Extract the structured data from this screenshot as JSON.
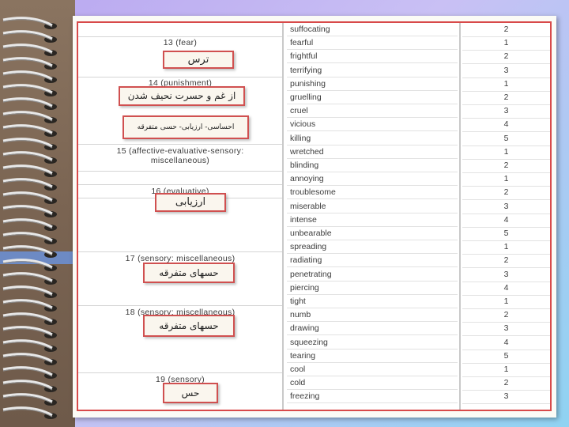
{
  "rows": [
    {
      "word": "suffocating",
      "value": "2"
    },
    {
      "word": "fearful",
      "value": "1"
    },
    {
      "word": "frightful",
      "value": "2"
    },
    {
      "word": "terrifying",
      "value": "3"
    },
    {
      "word": "punishing",
      "value": "1"
    },
    {
      "word": "gruelling",
      "value": "2"
    },
    {
      "word": "cruel",
      "value": "3"
    },
    {
      "word": "vicious",
      "value": "4"
    },
    {
      "word": "killing",
      "value": "5"
    },
    {
      "word": "wretched",
      "value": "1"
    },
    {
      "word": "blinding",
      "value": "2"
    },
    {
      "word": "annoying",
      "value": "1"
    },
    {
      "word": "troublesome",
      "value": "2"
    },
    {
      "word": "miserable",
      "value": "3"
    },
    {
      "word": "intense",
      "value": "4"
    },
    {
      "word": "unbearable",
      "value": "5"
    },
    {
      "word": "spreading",
      "value": "1"
    },
    {
      "word": "radiating",
      "value": "2"
    },
    {
      "word": "penetrating",
      "value": "3"
    },
    {
      "word": "piercing",
      "value": "4"
    },
    {
      "word": "tight",
      "value": "1"
    },
    {
      "word": "numb",
      "value": "2"
    },
    {
      "word": "drawing",
      "value": "3"
    },
    {
      "word": "squeezing",
      "value": "4"
    },
    {
      "word": "tearing",
      "value": "5"
    },
    {
      "word": "cool",
      "value": "1"
    },
    {
      "word": "cold",
      "value": "2"
    },
    {
      "word": "freezing",
      "value": "3"
    }
  ],
  "groups": {
    "g13": "13 (fear)",
    "g14": "14 (punishment)",
    "g15_line1": "15 (affective-evaluative-sensory:",
    "g15_line2": "miscellaneous)",
    "g16": "16 (evaluative)",
    "g17": "17 (sensory: miscellaneous)",
    "g18": "18 (sensory: miscellaneous)",
    "g19": "19 (sensory)"
  },
  "annotations": {
    "a13": "ترس",
    "a14": "از غم و حسرت نحیف شدن",
    "a15": "احساسی- ارزیابی- حسی متفرقه",
    "a16": "ارزیابی",
    "a17": "حسهای متفرقه",
    "a18": "حسهای متفرقه",
    "a19": "حس"
  },
  "colors": {
    "frame_border": "#d84a4a",
    "annotation_border": "#d05050"
  }
}
